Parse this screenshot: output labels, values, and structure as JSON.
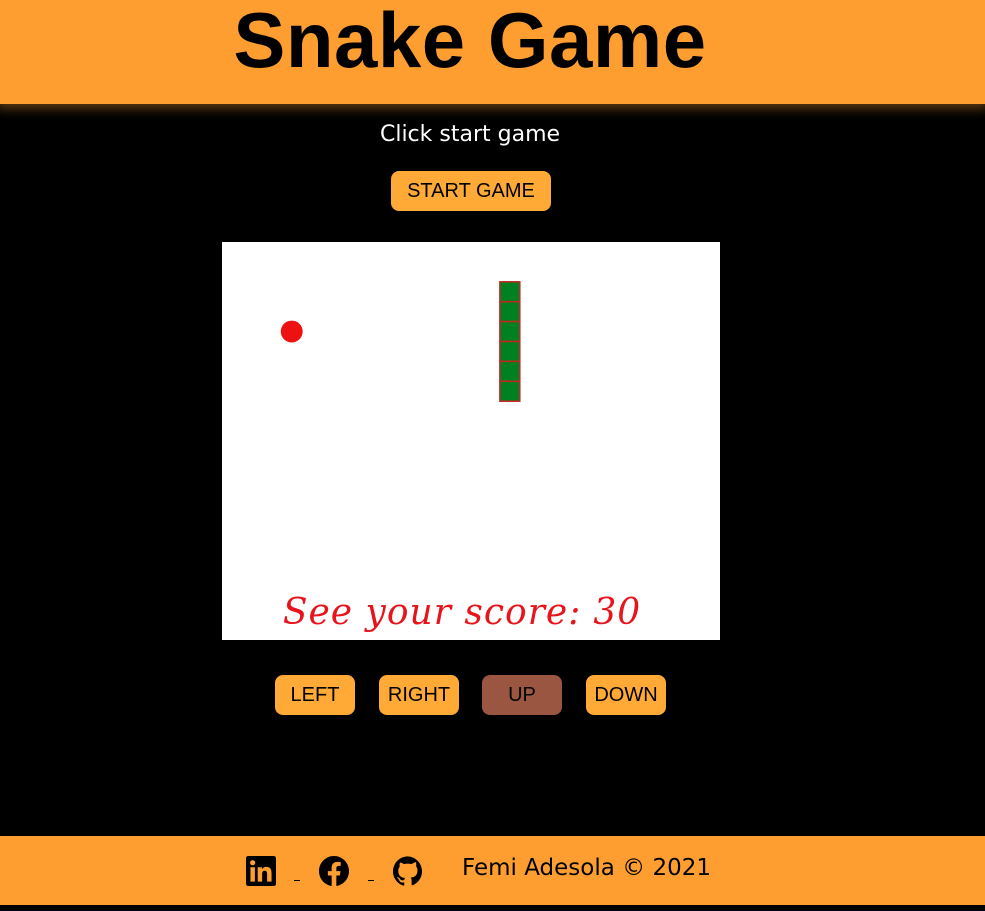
{
  "header": {
    "title": "Snake Game"
  },
  "instruction": "Click start game",
  "buttons": {
    "start": "START GAME",
    "left": "LEFT",
    "right": "RIGHT",
    "up": "UP",
    "down": "DOWN",
    "active": "up"
  },
  "game": {
    "score_label": "See your score:",
    "score_value": "30",
    "cols": 25,
    "rows": 20,
    "snake": [
      [
        14,
        2
      ],
      [
        14,
        3
      ],
      [
        14,
        4
      ],
      [
        14,
        5
      ],
      [
        14,
        6
      ],
      [
        14,
        7
      ]
    ],
    "food": [
      3,
      4
    ],
    "colors": {
      "snake": "#008020",
      "snake_border": "#c0281e",
      "food": "#ee1111",
      "board": "#ffffff"
    }
  },
  "footer": {
    "icons": [
      "linkedin-icon",
      "facebook-icon",
      "github-icon"
    ],
    "copyright": "Femi Adesola © 2021"
  },
  "colors": {
    "accent": "#ff9e30",
    "button": "#ffa936",
    "button_active": "#9a5640",
    "score_text": "#e8141c"
  }
}
